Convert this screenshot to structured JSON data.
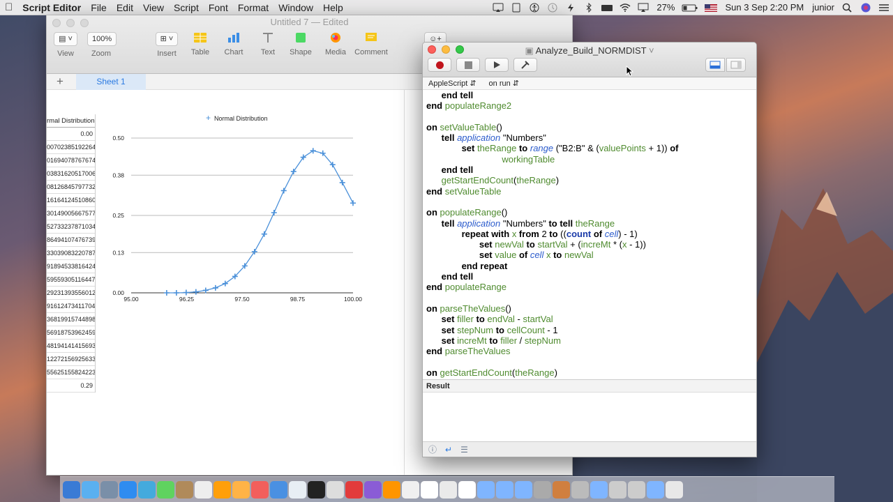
{
  "menubar": {
    "app": "Script Editor",
    "items": [
      "File",
      "Edit",
      "View",
      "Script",
      "Font",
      "Format",
      "Window",
      "Help"
    ],
    "battery": "27%",
    "clock": "Sun 3 Sep  2:20 PM",
    "user": "junior"
  },
  "numbers_window": {
    "title": "Untitled 7 — Edited",
    "toolbar": {
      "view": "View",
      "zoom_value": "100%",
      "zoom": "Zoom",
      "insert": "Insert",
      "table": "Table",
      "chart": "Chart",
      "text": "Text",
      "shape": "Shape",
      "media": "Media",
      "comment": "Comment"
    },
    "sheet_tab": "Sheet 1",
    "table_header": "rmal Distribution",
    "table_cells": [
      "0.00",
      "00702385192264",
      "01694078767674",
      "03831620517006",
      "08126845797732",
      "16164124510860",
      "30149005667577",
      "52733237871034",
      "86494107476739",
      "33039083220787",
      "91894533816424",
      "59559305116447",
      "29231393556012",
      "91612473411704",
      "36819915744898",
      "56918753962459",
      "48194141415693",
      "12272156925633",
      "55625155824223",
      "0.29"
    ]
  },
  "chart_data": {
    "type": "scatter",
    "legend": "Normal Distribution",
    "legend_position": "top",
    "xlim": [
      95.0,
      100.0
    ],
    "ylim": [
      0.0,
      0.5
    ],
    "x_ticks": [
      "95.00",
      "96.25",
      "97.50",
      "98.75",
      "100.00"
    ],
    "y_ticks": [
      "0.50",
      "0.38",
      "0.25",
      "0.13",
      "0.00"
    ],
    "grid": true,
    "series": [
      {
        "name": "Normal Distribution",
        "x": [
          95.8,
          96.02,
          96.24,
          96.46,
          96.68,
          96.9,
          97.12,
          97.34,
          97.56,
          97.78,
          98.0,
          98.22,
          98.44,
          98.66,
          98.88,
          99.1,
          99.32,
          99.54,
          99.76,
          100.0
        ],
        "y": [
          0.0,
          0.0,
          0.001,
          0.003,
          0.008,
          0.016,
          0.03,
          0.053,
          0.087,
          0.133,
          0.19,
          0.259,
          0.33,
          0.392,
          0.438,
          0.459,
          0.451,
          0.414,
          0.356,
          0.29
        ]
      }
    ]
  },
  "script_window": {
    "title": "Analyze_Build_NORMDIST",
    "nav_language": "AppleScript",
    "nav_handler": "on run",
    "result_label": "Result"
  },
  "code_lines": [
    [
      [
        "kw",
        "      end tell"
      ]
    ],
    [
      [
        "kw",
        "end "
      ],
      [
        "vr",
        "populateRange2"
      ]
    ],
    [],
    [
      [
        "kw",
        "on "
      ],
      [
        "vr",
        "setValueTable"
      ],
      [
        "st",
        "()"
      ]
    ],
    [
      [
        "kw",
        "      tell "
      ],
      [
        "ap",
        "application"
      ],
      [
        "st",
        " \"Numbers\""
      ]
    ],
    [
      [
        "kw",
        "              set "
      ],
      [
        "vr",
        "theRange"
      ],
      [
        "kw",
        " to "
      ],
      [
        "ap",
        "range"
      ],
      [
        "st",
        " (\"B2:B\" & ("
      ],
      [
        "vr",
        "valuePoints"
      ],
      [
        "st",
        " + 1)) "
      ],
      [
        "kw",
        "of"
      ]
    ],
    [
      [
        "vr",
        "                              workingTable"
      ]
    ],
    [
      [
        "kw",
        "      end tell"
      ]
    ],
    [
      [
        "vr",
        "      getStartEndCount"
      ],
      [
        "st",
        "("
      ],
      [
        "vr",
        "theRange"
      ],
      [
        "st",
        ")"
      ]
    ],
    [
      [
        "kw",
        "end "
      ],
      [
        "vr",
        "setValueTable"
      ]
    ],
    [],
    [
      [
        "kw",
        "on "
      ],
      [
        "vr",
        "populateRange"
      ],
      [
        "st",
        "()"
      ]
    ],
    [
      [
        "kw",
        "      tell "
      ],
      [
        "ap",
        "application"
      ],
      [
        "st",
        " \"Numbers\" "
      ],
      [
        "kw",
        "to tell "
      ],
      [
        "vr",
        "theRange"
      ]
    ],
    [
      [
        "kw",
        "              repeat with "
      ],
      [
        "vr",
        "x"
      ],
      [
        "kw",
        " from "
      ],
      [
        "st",
        "2 "
      ],
      [
        "kw",
        "to "
      ],
      [
        "st",
        "(("
      ],
      [
        "ap2",
        "count"
      ],
      [
        "kw",
        " of "
      ],
      [
        "ap",
        "cell"
      ],
      [
        "st",
        ") - 1)"
      ]
    ],
    [
      [
        "kw",
        "                     set "
      ],
      [
        "vr",
        "newVal"
      ],
      [
        "kw",
        " to "
      ],
      [
        "vr",
        "startVal"
      ],
      [
        "st",
        " + ("
      ],
      [
        "vr",
        "increMt"
      ],
      [
        "st",
        " * ("
      ],
      [
        "vr",
        "x"
      ],
      [
        "st",
        " - 1))"
      ]
    ],
    [
      [
        "kw",
        "                     set "
      ],
      [
        "vr",
        "value"
      ],
      [
        "kw",
        " of "
      ],
      [
        "ap",
        "cell"
      ],
      [
        "st",
        " "
      ],
      [
        "vr",
        "x"
      ],
      [
        "kw",
        " to "
      ],
      [
        "vr",
        "newVal"
      ]
    ],
    [
      [
        "kw",
        "              end repeat"
      ]
    ],
    [
      [
        "kw",
        "      end tell"
      ]
    ],
    [
      [
        "kw",
        "end "
      ],
      [
        "vr",
        "populateRange"
      ]
    ],
    [],
    [
      [
        "kw",
        "on "
      ],
      [
        "vr",
        "parseTheValues"
      ],
      [
        "st",
        "()"
      ]
    ],
    [
      [
        "kw",
        "      set "
      ],
      [
        "vr",
        "filler"
      ],
      [
        "kw",
        " to "
      ],
      [
        "vr",
        "endVal"
      ],
      [
        "st",
        " - "
      ],
      [
        "vr",
        "startVal"
      ]
    ],
    [
      [
        "kw",
        "      set "
      ],
      [
        "vr",
        "stepNum"
      ],
      [
        "kw",
        " to "
      ],
      [
        "vr",
        "cellCount"
      ],
      [
        "st",
        " - 1"
      ]
    ],
    [
      [
        "kw",
        "      set "
      ],
      [
        "vr",
        "increMt"
      ],
      [
        "kw",
        " to "
      ],
      [
        "vr",
        "filler"
      ],
      [
        "st",
        " / "
      ],
      [
        "vr",
        "stepNum"
      ]
    ],
    [
      [
        "kw",
        "end "
      ],
      [
        "vr",
        "parseTheValues"
      ]
    ],
    [],
    [
      [
        "kw",
        "on "
      ],
      [
        "vr",
        "getStartEndCount"
      ],
      [
        "st",
        "("
      ],
      [
        "vr",
        "theRange"
      ],
      [
        "st",
        ")"
      ]
    ]
  ]
}
